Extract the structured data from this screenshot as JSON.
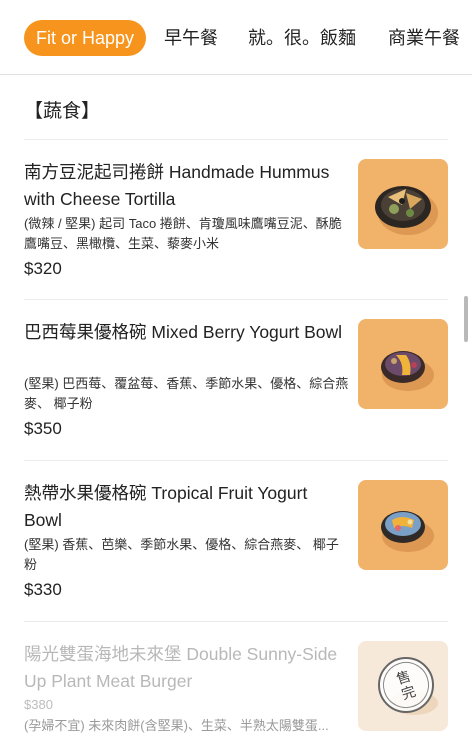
{
  "tabs": [
    {
      "label": "Fit or Happy",
      "active": true
    },
    {
      "label": "早午餐",
      "active": false
    },
    {
      "label": "就。很。飯麵",
      "active": false
    },
    {
      "label": "商業午餐",
      "active": false
    }
  ],
  "section": {
    "title": "【蔬食】"
  },
  "items": [
    {
      "name": "南方豆泥起司捲餅 Handmade Hummus with Cheese Tortilla",
      "description": "(微辣 / 堅果) 起司 Taco 捲餅、肯瓊風味鷹嘴豆泥、酥脆鷹嘴豆、黑橄欖、生菜、藜麥小米",
      "price": "$320",
      "image": "tortilla-bowl-icon",
      "sold_out": false
    },
    {
      "name": "巴西莓果優格碗 Mixed Berry Yogurt Bowl",
      "description": "(堅果) 巴西莓、覆盆莓、香蕉、季節水果、優格、綜合燕麥、 椰子粉",
      "price": "$350",
      "image": "berry-bowl-icon",
      "sold_out": false
    },
    {
      "name": "熱帶水果優格碗 Tropical Fruit Yogurt Bowl",
      "description": "(堅果) 香蕉、芭樂、季節水果、優格、綜合燕麥、 椰子粉",
      "price": "$330",
      "image": "tropical-bowl-icon",
      "sold_out": false
    },
    {
      "name": "陽光雙蛋海地未來堡 Double Sunny-Side Up Plant Meat Burger",
      "description": "(孕婦不宜) 未來肉餅(含堅果)、生菜、半熟太陽雙蛋...",
      "price": "$380",
      "image": "burger-icon",
      "sold_out": true,
      "sold_out_label_1": "售",
      "sold_out_label_2": "完"
    }
  ],
  "colors": {
    "accent": "#f7941d",
    "thumb_bg": "#f1b26a"
  }
}
